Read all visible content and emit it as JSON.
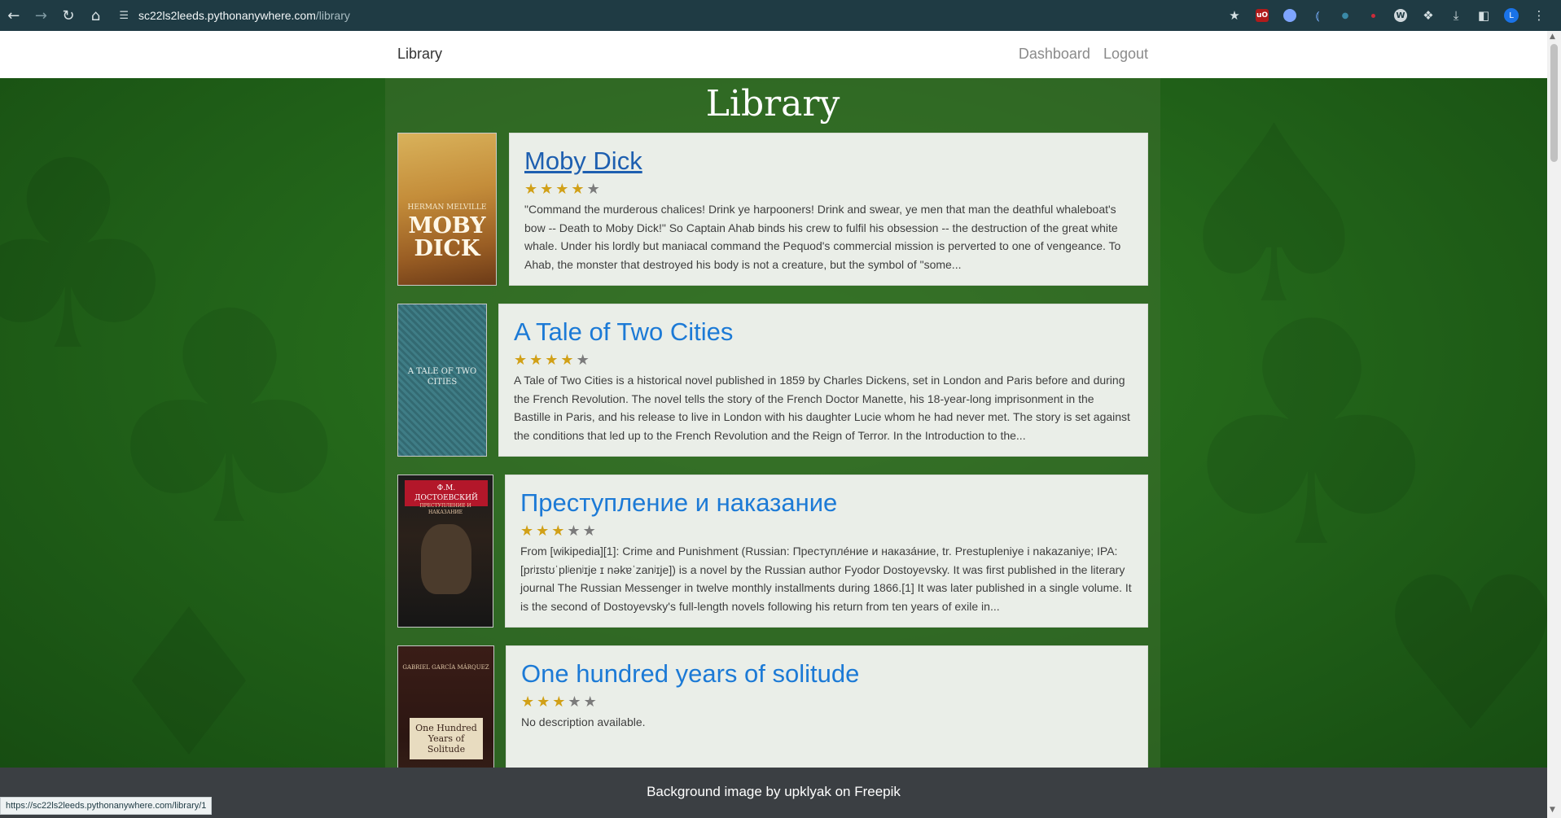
{
  "browser": {
    "url_host": "sc22ls2leeds.pythonanywhere.com",
    "url_path": "/library",
    "status_url": "https://sc22ls2leeds.pythonanywhere.com/library/1",
    "avatar_letter": "L",
    "ublock_label": "uO"
  },
  "navbar": {
    "brand": "Library",
    "links": [
      "Dashboard",
      "Logout"
    ]
  },
  "main": {
    "title": "Library",
    "books": [
      {
        "title": "Moby Dick",
        "rating": 4,
        "max_rating": 5,
        "description": "\"Command the murderous chalices! Drink ye harpooners! Drink and swear, ye men that man the deathful whaleboat's bow -- Death to Moby Dick!\" So Captain Ahab binds his crew to fulfil his obsession -- the destruction of the great white whale. Under his lordly but maniacal command the Pequod's commercial mission is perverted to one of vengeance. To Ahab, the monster that destroyed his body is not a creature, but the symbol of \"some...",
        "cover_text_top": "HERMAN MELVILLE",
        "cover_text_main": "MOBY DICK"
      },
      {
        "title": "A Tale of Two Cities",
        "rating": 4,
        "max_rating": 5,
        "description": "A Tale of Two Cities is a historical novel published in 1859 by Charles Dickens, set in London and Paris before and during the French Revolution. The novel tells the story of the French Doctor Manette, his 18-year-long imprisonment in the Bastille in Paris, and his release to live in London with his daughter Lucie whom he had never met. The story is set against the conditions that led up to the French Revolution and the Reign of Terror. In the Introduction to the...",
        "cover_text_main": "A TALE OF TWO CITIES"
      },
      {
        "title": "Преступление и наказание",
        "rating": 3,
        "max_rating": 5,
        "description": "From [wikipedia][1]: Crime and Punishment (Russian: Преступле́ние и наказа́ние, tr. Prestupleniye i nakazaniye; IPA: [prʲɪstʊˈplʲenʲɪje ɪ nəkɐˈzanʲɪje]) is a novel by the Russian author Fyodor Dostoyevsky. It was first published in the literary journal The Russian Messenger in twelve monthly installments during 1866.[1] It was later published in a single volume. It is the second of Dostoyevsky's full-length novels following his return from ten years of exile in...",
        "cover_text_top": "Ф.М. ДОСТОЕВСКИЙ",
        "cover_text_main": "ПРЕСТУПЛЕНИЕ И НАКАЗАНИЕ"
      },
      {
        "title": "One hundred years of solitude",
        "rating": 3,
        "max_rating": 5,
        "description": "No description available.",
        "cover_text_top": "GABRIEL GARCÍA MÁRQUEZ",
        "cover_text_main": "One Hundred Years of Solitude"
      }
    ]
  },
  "footer": {
    "text": "Background image by upklyak on Freepik"
  }
}
